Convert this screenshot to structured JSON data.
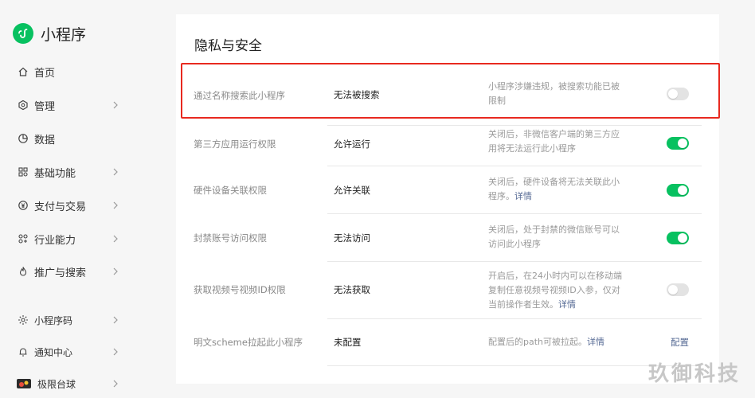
{
  "brand": {
    "name": "小程序",
    "accent": "#07c160"
  },
  "sidebar": {
    "items": [
      {
        "label": "首页",
        "icon": "home-icon",
        "chevron": false
      },
      {
        "label": "管理",
        "icon": "manage-icon",
        "chevron": true
      },
      {
        "label": "数据",
        "icon": "data-icon",
        "chevron": false
      },
      {
        "label": "基础功能",
        "icon": "grid-icon",
        "chevron": true
      },
      {
        "label": "支付与交易",
        "icon": "yen-icon",
        "chevron": true
      },
      {
        "label": "行业能力",
        "icon": "industry-icon",
        "chevron": true
      },
      {
        "label": "推广与搜索",
        "icon": "flame-icon",
        "chevron": true
      }
    ],
    "bottom_items": [
      {
        "label": "小程序码",
        "icon": "sun-icon",
        "chevron": true
      },
      {
        "label": "通知中心",
        "icon": "bell-icon",
        "chevron": true
      },
      {
        "label": "极限台球",
        "icon": "avatar-icon",
        "chevron": true
      }
    ]
  },
  "section": {
    "title": "隐私与安全",
    "rows": [
      {
        "name": "通过名称搜索此小程序",
        "status": "无法被搜索",
        "desc": "小程序涉嫌违规，被搜索功能已被限制",
        "link": "",
        "control": "toggle",
        "on": false
      },
      {
        "name": "第三方应用运行权限",
        "status": "允许运行",
        "desc": "关闭后，非微信客户端的第三方应用将无法运行此小程序",
        "link": "",
        "control": "toggle",
        "on": true
      },
      {
        "name": "硬件设备关联权限",
        "status": "允许关联",
        "desc": "关闭后，硬件设备将无法关联此小程序。",
        "link": "详情",
        "control": "toggle",
        "on": true
      },
      {
        "name": "封禁账号访问权限",
        "status": "无法访问",
        "desc": "关闭后，处于封禁的微信账号可以访问此小程序",
        "link": "",
        "control": "toggle",
        "on": true
      },
      {
        "name": "获取视频号视频ID权限",
        "status": "无法获取",
        "desc": "开启后，在24小时内可以在移动端复制任意视频号视频ID入参，仅对当前操作者生效。",
        "link": "详情",
        "control": "toggle",
        "on": false
      },
      {
        "name": "明文scheme拉起此小程序",
        "status": "未配置",
        "desc": "配置后的path可被拉起。",
        "link": "详情",
        "control": "link",
        "control_label": "配置"
      }
    ]
  },
  "watermark": "玖御科技",
  "colors": {
    "highlight": "#e8291f",
    "link": "#576b95",
    "toggle_on": "#07c160",
    "toggle_off": "#e3e3e3"
  }
}
